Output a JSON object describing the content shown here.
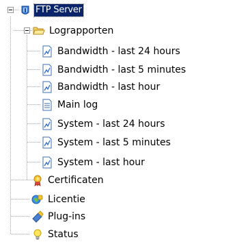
{
  "tree": {
    "root": {
      "label": "FTP Server",
      "icon": "ftp-server-icon",
      "expanded": true,
      "selected": true
    },
    "lograpporten": {
      "label": "Lograpporten",
      "icon": "open-folder-icon",
      "expanded": true,
      "children": [
        {
          "label": "Bandwidth - last 24 hours",
          "icon": "report-chart-icon"
        },
        {
          "label": "Bandwidth - last 5 minutes",
          "icon": "report-chart-icon"
        },
        {
          "label": "Bandwidth - last hour",
          "icon": "report-chart-icon"
        },
        {
          "label": "Main log",
          "icon": "text-document-icon"
        },
        {
          "label": "System - last 24 hours",
          "icon": "report-chart-icon"
        },
        {
          "label": "System - last 5 minutes",
          "icon": "report-chart-icon"
        },
        {
          "label": "System - last hour",
          "icon": "report-chart-icon"
        }
      ]
    },
    "certificaten": {
      "label": "Certificaten",
      "icon": "certificate-icon"
    },
    "licentie": {
      "label": "Licentie",
      "icon": "license-icon"
    },
    "plugins": {
      "label": "Plug-ins",
      "icon": "plugin-icon"
    },
    "status": {
      "label": "Status",
      "icon": "lightbulb-icon"
    }
  },
  "colors": {
    "selection": "#0a246a",
    "connector": "#a0a0a0",
    "expander_border": "#919b9c"
  }
}
